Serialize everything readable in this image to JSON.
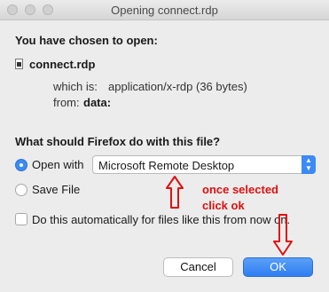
{
  "window": {
    "title": "Opening connect.rdp"
  },
  "dialog": {
    "heading": "You have chosen to open:",
    "file_name": "connect.rdp",
    "type_prefix": "which is:",
    "type_value": "application/x-rdp (36 bytes)",
    "from_label": "from:",
    "from_value": "data:",
    "question": "What should Firefox do with this file?",
    "open_with_label": "Open with",
    "app_selected": "Microsoft Remote Desktop",
    "save_file_label": "Save File",
    "auto_label": "Do this automatically for files like this from now on.",
    "cancel_label": "Cancel",
    "ok_label": "OK"
  },
  "annotation": {
    "line1": "once selected",
    "line2": "click ok",
    "color": "#e01010"
  },
  "colors": {
    "accent": "#3b8af5",
    "background": "#ececec"
  }
}
